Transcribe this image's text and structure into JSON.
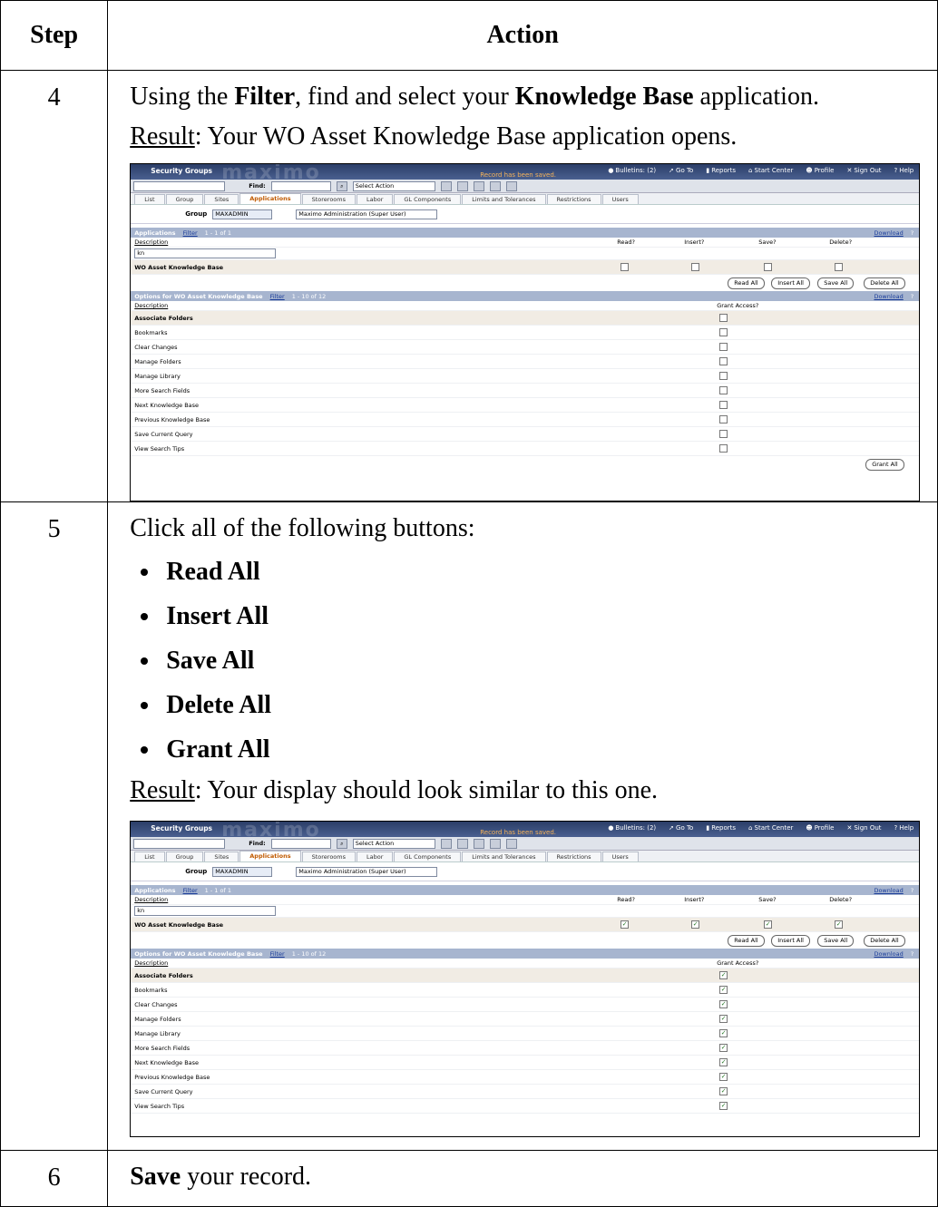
{
  "header": {
    "step": "Step",
    "action": "Action"
  },
  "rows": [
    {
      "step": "4",
      "line1_a": "Using the ",
      "line1_b": "Filter",
      "line1_c": ", find and select your ",
      "line1_d": "Knowledge Base",
      "line1_e": " application.",
      "result_label": "Result",
      "result_text": ": Your WO Asset Knowledge Base application opens."
    },
    {
      "step": "5",
      "intro": "Click all of the following buttons:",
      "bullets": [
        "Read All",
        "Insert All",
        "Save All",
        "Delete All",
        "Grant All"
      ],
      "result_label": "Result",
      "result_text": ": Your display should look similar to this one."
    },
    {
      "step": "6",
      "bold": "Save",
      "rest": " your record."
    }
  ],
  "screenshot": {
    "app_title": "Security Groups",
    "logo": "maximo",
    "message": "Record has been saved.",
    "links": [
      "Bulletins: (2)",
      "Go To",
      "Reports",
      "Start Center",
      "Profile",
      "Sign Out",
      "Help"
    ],
    "find_label": "Find:",
    "select_action": "Select Action",
    "tabs": [
      "List",
      "Group",
      "Sites",
      "Applications",
      "Storerooms",
      "Labor",
      "GL Components",
      "Limits and Tolerances",
      "Restrictions",
      "Users"
    ],
    "group_label": "Group",
    "group_value": "MAXADMIN",
    "group_desc": "Maximo Administration (Super User)",
    "apps_section": "Applications",
    "filter": "Filter",
    "apps_paging": "1 - 1 of 1",
    "download": "Download",
    "description_header": "Description",
    "filter_value": "kn",
    "col_read": "Read?",
    "col_insert": "Insert?",
    "col_save": "Save?",
    "col_delete": "Delete?",
    "app_row": "WO Asset Knowledge Base",
    "buttons": [
      "Read All",
      "Insert All",
      "Save All",
      "Delete All"
    ],
    "options_section": "Options for WO Asset Knowledge Base",
    "options_paging": "1 - 10 of 12",
    "grant_access": "Grant Access?",
    "options": [
      "Associate Folders",
      "Bookmarks",
      "Clear Changes",
      "Manage Folders",
      "Manage Library",
      "More Search Fields",
      "Next Knowledge Base",
      "Previous Knowledge Base",
      "Save Current Query",
      "View Search Tips"
    ],
    "grant_all": "Grant All"
  }
}
